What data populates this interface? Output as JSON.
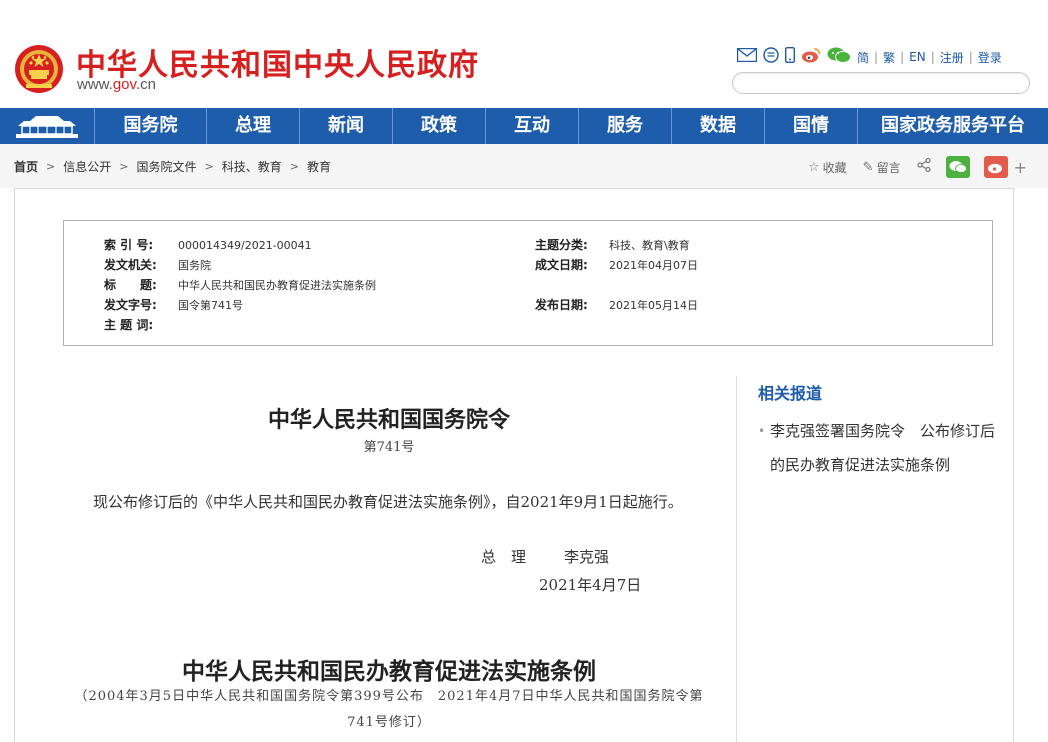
{
  "header": {
    "site_title": "中华人民共和国中央人民政府",
    "site_url_prefix": "www.",
    "site_url_domain": "gov",
    "site_url_suffix": ".cn",
    "links": [
      "简",
      "繁",
      "EN",
      "注册",
      "登录"
    ]
  },
  "nav": {
    "items": [
      "国务院",
      "总理",
      "新闻",
      "政策",
      "互动",
      "服务",
      "数据",
      "国情",
      "国家政务服务平台"
    ]
  },
  "breadcrumb": {
    "items": [
      "首页",
      "信息公开",
      "国务院文件",
      "科技、教育",
      "教育"
    ],
    "separator": ">"
  },
  "tools": {
    "favorite": "收藏",
    "comment": "留言",
    "plus": "+"
  },
  "info": {
    "index_label": "索 引 号:",
    "index_value": "000014349/2021-00041",
    "topic_label": "主题分类:",
    "topic_value": "科技、教育\\教育",
    "issuer_label": "发文机关:",
    "issuer_value": "国务院",
    "created_label": "成文日期:",
    "created_value": "2021年04月07日",
    "title_label": "标　　题:",
    "title_value": "中华人民共和国民办教育促进法实施条例",
    "docnum_label": "发文字号:",
    "docnum_value": "国令第741号",
    "published_label": "发布日期:",
    "published_value": "2021年05月14日",
    "keywords_label": "主 题 词:",
    "keywords_value": ""
  },
  "related": {
    "title": "相关报道",
    "bullet": "•",
    "items": [
      "李克强签署国务院令　公布修订后的民办教育促进法实施条例"
    ]
  },
  "article": {
    "title": "中华人民共和国国务院令",
    "number": "第741号",
    "paragraph": "现公布修订后的《中华人民共和国民办教育促进法实施条例》，自2021年9月1日起施行。",
    "sign_role": "总　理",
    "sign_name": "李克强",
    "date": "2021年4月7日",
    "title2": "中华人民共和国民办教育促进法实施条例",
    "subtitle": "（2004年3月5日中华人民共和国国务院令第399号公布　2021年4月7日中华人民共和国国务院令第741号修订）"
  },
  "colors": {
    "brand_red": "#d61f1f",
    "nav_blue": "#1d5dab",
    "wechat_green": "#4bb33d",
    "weibo_red": "#e25b4b"
  }
}
